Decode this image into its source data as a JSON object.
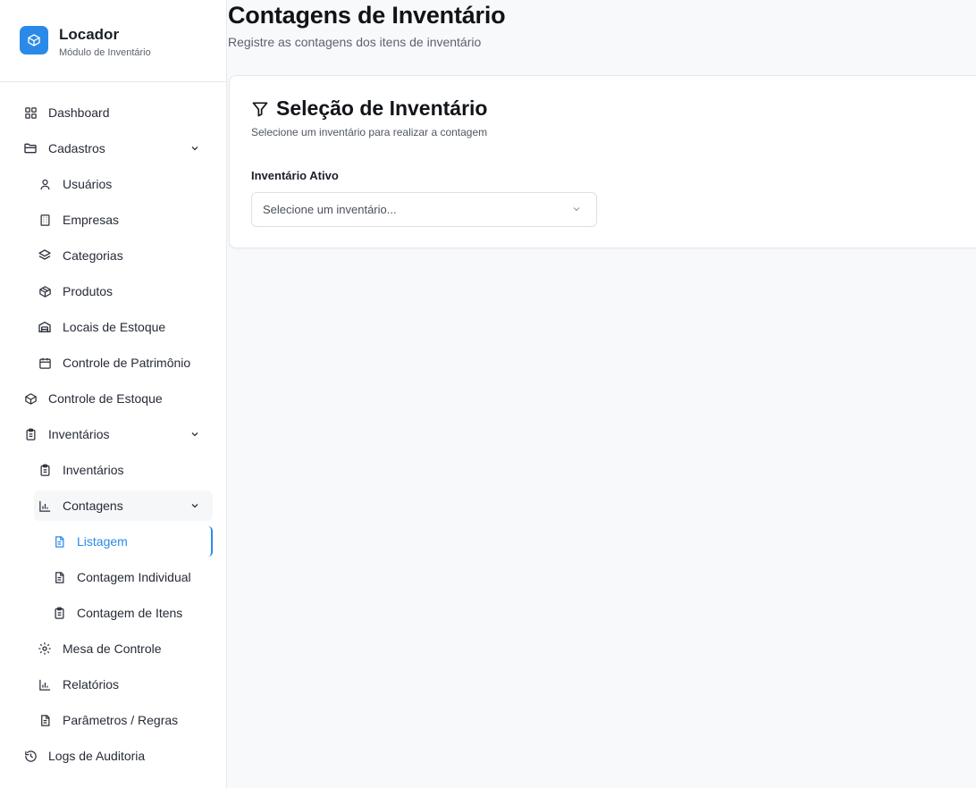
{
  "brand": {
    "name": "Locador",
    "subtitle": "Módulo de Inventário",
    "logo_icon": "cube-icon",
    "accent": "#2b8ae8"
  },
  "sidebar": {
    "items": [
      {
        "label": "Dashboard",
        "icon": "grid-icon"
      },
      {
        "label": "Cadastros",
        "icon": "folder-icon",
        "expanded": true
      },
      {
        "label": "Usuários",
        "icon": "user-icon"
      },
      {
        "label": "Empresas",
        "icon": "building-icon"
      },
      {
        "label": "Categorias",
        "icon": "layers-icon"
      },
      {
        "label": "Produtos",
        "icon": "package-icon"
      },
      {
        "label": "Locais de Estoque",
        "icon": "warehouse-icon"
      },
      {
        "label": "Controle de Patrimônio",
        "icon": "calendar-icon"
      },
      {
        "label": "Controle de Estoque",
        "icon": "box-icon"
      },
      {
        "label": "Inventários",
        "icon": "clipboard-icon",
        "expanded": true
      },
      {
        "label": "Inventários",
        "icon": "clipboard-icon"
      },
      {
        "label": "Contagens",
        "icon": "bar-chart-icon",
        "expanded": true
      },
      {
        "label": "Listagem",
        "icon": "file-text-icon",
        "active": true
      },
      {
        "label": "Contagem Individual",
        "icon": "file-text-icon"
      },
      {
        "label": "Contagem de Itens",
        "icon": "clipboard-list-icon"
      },
      {
        "label": "Mesa de Controle",
        "icon": "settings-icon"
      },
      {
        "label": "Relatórios",
        "icon": "bar-chart-icon"
      },
      {
        "label": "Parâmetros / Regras",
        "icon": "file-text-icon"
      },
      {
        "label": "Logs de Auditoria",
        "icon": "history-icon"
      }
    ]
  },
  "page": {
    "title": "Contagens de Inventário",
    "subtitle": "Registre as contagens dos itens de inventário"
  },
  "card": {
    "title": "Seleção de Inventário",
    "title_icon": "filter-icon",
    "subtitle": "Selecione um inventário para realizar a contagem",
    "field_label": "Inventário Ativo",
    "select_placeholder": "Selecione um inventário..."
  }
}
